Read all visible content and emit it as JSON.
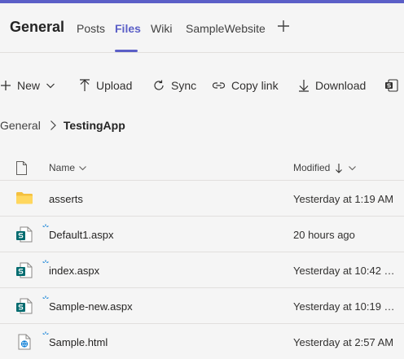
{
  "header": {
    "title": "General",
    "tabs": [
      {
        "label": "Posts"
      },
      {
        "label": "Files"
      },
      {
        "label": "Wiki"
      },
      {
        "label": "SampleWebsite"
      }
    ],
    "add_tab_icon": "plus-icon",
    "accent_color": "#5b5fc7"
  },
  "toolbar": {
    "new_label": "New",
    "upload_label": "Upload",
    "sync_label": "Sync",
    "copy_link_label": "Copy link",
    "download_label": "Download"
  },
  "breadcrumb": {
    "parent": "General",
    "current": "TestingApp"
  },
  "files": {
    "columns": {
      "name": "Name",
      "modified": "Modified"
    },
    "sort": {
      "column": "modified",
      "direction": "descending"
    },
    "rows": [
      {
        "name": "asserts",
        "modified": "Yesterday at 1:19 AM",
        "icon": "folder-icon"
      },
      {
        "name": "Default1.aspx",
        "modified": "20 hours ago",
        "icon": "sharepoint-file-icon"
      },
      {
        "name": "index.aspx",
        "modified": "Yesterday at 10:42 …",
        "icon": "sharepoint-file-icon"
      },
      {
        "name": "Sample-new.aspx",
        "modified": "Yesterday at 10:19 …",
        "icon": "sharepoint-file-icon"
      },
      {
        "name": "Sample.html",
        "modified": "Yesterday at 2:57 AM",
        "icon": "html-file-icon"
      }
    ]
  }
}
